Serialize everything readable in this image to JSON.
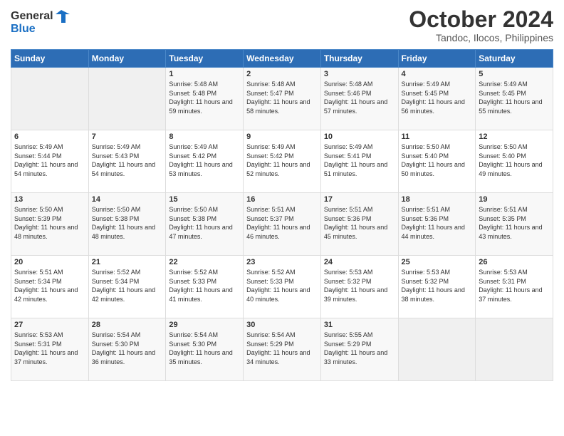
{
  "header": {
    "logo_line1": "General",
    "logo_line2": "Blue",
    "month_title": "October 2024",
    "location": "Tandoc, Ilocos, Philippines"
  },
  "weekdays": [
    "Sunday",
    "Monday",
    "Tuesday",
    "Wednesday",
    "Thursday",
    "Friday",
    "Saturday"
  ],
  "weeks": [
    [
      {
        "day": "",
        "sunrise": "",
        "sunset": "",
        "daylight": ""
      },
      {
        "day": "",
        "sunrise": "",
        "sunset": "",
        "daylight": ""
      },
      {
        "day": "1",
        "sunrise": "Sunrise: 5:48 AM",
        "sunset": "Sunset: 5:48 PM",
        "daylight": "Daylight: 11 hours and 59 minutes."
      },
      {
        "day": "2",
        "sunrise": "Sunrise: 5:48 AM",
        "sunset": "Sunset: 5:47 PM",
        "daylight": "Daylight: 11 hours and 58 minutes."
      },
      {
        "day": "3",
        "sunrise": "Sunrise: 5:48 AM",
        "sunset": "Sunset: 5:46 PM",
        "daylight": "Daylight: 11 hours and 57 minutes."
      },
      {
        "day": "4",
        "sunrise": "Sunrise: 5:49 AM",
        "sunset": "Sunset: 5:45 PM",
        "daylight": "Daylight: 11 hours and 56 minutes."
      },
      {
        "day": "5",
        "sunrise": "Sunrise: 5:49 AM",
        "sunset": "Sunset: 5:45 PM",
        "daylight": "Daylight: 11 hours and 55 minutes."
      }
    ],
    [
      {
        "day": "6",
        "sunrise": "Sunrise: 5:49 AM",
        "sunset": "Sunset: 5:44 PM",
        "daylight": "Daylight: 11 hours and 54 minutes."
      },
      {
        "day": "7",
        "sunrise": "Sunrise: 5:49 AM",
        "sunset": "Sunset: 5:43 PM",
        "daylight": "Daylight: 11 hours and 54 minutes."
      },
      {
        "day": "8",
        "sunrise": "Sunrise: 5:49 AM",
        "sunset": "Sunset: 5:42 PM",
        "daylight": "Daylight: 11 hours and 53 minutes."
      },
      {
        "day": "9",
        "sunrise": "Sunrise: 5:49 AM",
        "sunset": "Sunset: 5:42 PM",
        "daylight": "Daylight: 11 hours and 52 minutes."
      },
      {
        "day": "10",
        "sunrise": "Sunrise: 5:49 AM",
        "sunset": "Sunset: 5:41 PM",
        "daylight": "Daylight: 11 hours and 51 minutes."
      },
      {
        "day": "11",
        "sunrise": "Sunrise: 5:50 AM",
        "sunset": "Sunset: 5:40 PM",
        "daylight": "Daylight: 11 hours and 50 minutes."
      },
      {
        "day": "12",
        "sunrise": "Sunrise: 5:50 AM",
        "sunset": "Sunset: 5:40 PM",
        "daylight": "Daylight: 11 hours and 49 minutes."
      }
    ],
    [
      {
        "day": "13",
        "sunrise": "Sunrise: 5:50 AM",
        "sunset": "Sunset: 5:39 PM",
        "daylight": "Daylight: 11 hours and 48 minutes."
      },
      {
        "day": "14",
        "sunrise": "Sunrise: 5:50 AM",
        "sunset": "Sunset: 5:38 PM",
        "daylight": "Daylight: 11 hours and 48 minutes."
      },
      {
        "day": "15",
        "sunrise": "Sunrise: 5:50 AM",
        "sunset": "Sunset: 5:38 PM",
        "daylight": "Daylight: 11 hours and 47 minutes."
      },
      {
        "day": "16",
        "sunrise": "Sunrise: 5:51 AM",
        "sunset": "Sunset: 5:37 PM",
        "daylight": "Daylight: 11 hours and 46 minutes."
      },
      {
        "day": "17",
        "sunrise": "Sunrise: 5:51 AM",
        "sunset": "Sunset: 5:36 PM",
        "daylight": "Daylight: 11 hours and 45 minutes."
      },
      {
        "day": "18",
        "sunrise": "Sunrise: 5:51 AM",
        "sunset": "Sunset: 5:36 PM",
        "daylight": "Daylight: 11 hours and 44 minutes."
      },
      {
        "day": "19",
        "sunrise": "Sunrise: 5:51 AM",
        "sunset": "Sunset: 5:35 PM",
        "daylight": "Daylight: 11 hours and 43 minutes."
      }
    ],
    [
      {
        "day": "20",
        "sunrise": "Sunrise: 5:51 AM",
        "sunset": "Sunset: 5:34 PM",
        "daylight": "Daylight: 11 hours and 42 minutes."
      },
      {
        "day": "21",
        "sunrise": "Sunrise: 5:52 AM",
        "sunset": "Sunset: 5:34 PM",
        "daylight": "Daylight: 11 hours and 42 minutes."
      },
      {
        "day": "22",
        "sunrise": "Sunrise: 5:52 AM",
        "sunset": "Sunset: 5:33 PM",
        "daylight": "Daylight: 11 hours and 41 minutes."
      },
      {
        "day": "23",
        "sunrise": "Sunrise: 5:52 AM",
        "sunset": "Sunset: 5:33 PM",
        "daylight": "Daylight: 11 hours and 40 minutes."
      },
      {
        "day": "24",
        "sunrise": "Sunrise: 5:53 AM",
        "sunset": "Sunset: 5:32 PM",
        "daylight": "Daylight: 11 hours and 39 minutes."
      },
      {
        "day": "25",
        "sunrise": "Sunrise: 5:53 AM",
        "sunset": "Sunset: 5:32 PM",
        "daylight": "Daylight: 11 hours and 38 minutes."
      },
      {
        "day": "26",
        "sunrise": "Sunrise: 5:53 AM",
        "sunset": "Sunset: 5:31 PM",
        "daylight": "Daylight: 11 hours and 37 minutes."
      }
    ],
    [
      {
        "day": "27",
        "sunrise": "Sunrise: 5:53 AM",
        "sunset": "Sunset: 5:31 PM",
        "daylight": "Daylight: 11 hours and 37 minutes."
      },
      {
        "day": "28",
        "sunrise": "Sunrise: 5:54 AM",
        "sunset": "Sunset: 5:30 PM",
        "daylight": "Daylight: 11 hours and 36 minutes."
      },
      {
        "day": "29",
        "sunrise": "Sunrise: 5:54 AM",
        "sunset": "Sunset: 5:30 PM",
        "daylight": "Daylight: 11 hours and 35 minutes."
      },
      {
        "day": "30",
        "sunrise": "Sunrise: 5:54 AM",
        "sunset": "Sunset: 5:29 PM",
        "daylight": "Daylight: 11 hours and 34 minutes."
      },
      {
        "day": "31",
        "sunrise": "Sunrise: 5:55 AM",
        "sunset": "Sunset: 5:29 PM",
        "daylight": "Daylight: 11 hours and 33 minutes."
      },
      {
        "day": "",
        "sunrise": "",
        "sunset": "",
        "daylight": ""
      },
      {
        "day": "",
        "sunrise": "",
        "sunset": "",
        "daylight": ""
      }
    ]
  ]
}
